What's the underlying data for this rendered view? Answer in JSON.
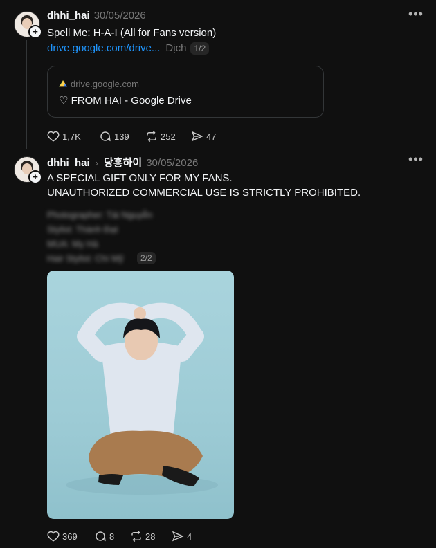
{
  "posts": [
    {
      "username": "dhhi_hai",
      "time": "30/05/2026",
      "title": "Spell Me: H-A-I (All for Fans version)",
      "link": "drive.google.com/drive...",
      "translate": "Dịch",
      "pager": "1/2",
      "card": {
        "domain": "drive.google.com",
        "title": "♡ FROM HAI - Google Drive"
      },
      "actions": {
        "likes": "1,7K",
        "comments": "139",
        "reposts": "252",
        "shares": "47"
      }
    },
    {
      "username": "dhhi_hai",
      "tag": "당홍하이",
      "time": "30/05/2026",
      "line1": "A SPECIAL GIFT ONLY FOR MY FANS.",
      "line2": "UNAUTHORIZED COMMERCIAL USE IS STRICTLY PROHIBITED.",
      "blurred": [
        "Photographer: Tài Nguyễn",
        "Stylist: Thành Đạt",
        "MUA: My Hà",
        "Hair Stylist: Chí Mỹ"
      ],
      "pager": "2/2",
      "actions": {
        "likes": "369",
        "comments": "8",
        "reposts": "28",
        "shares": "4"
      }
    }
  ]
}
